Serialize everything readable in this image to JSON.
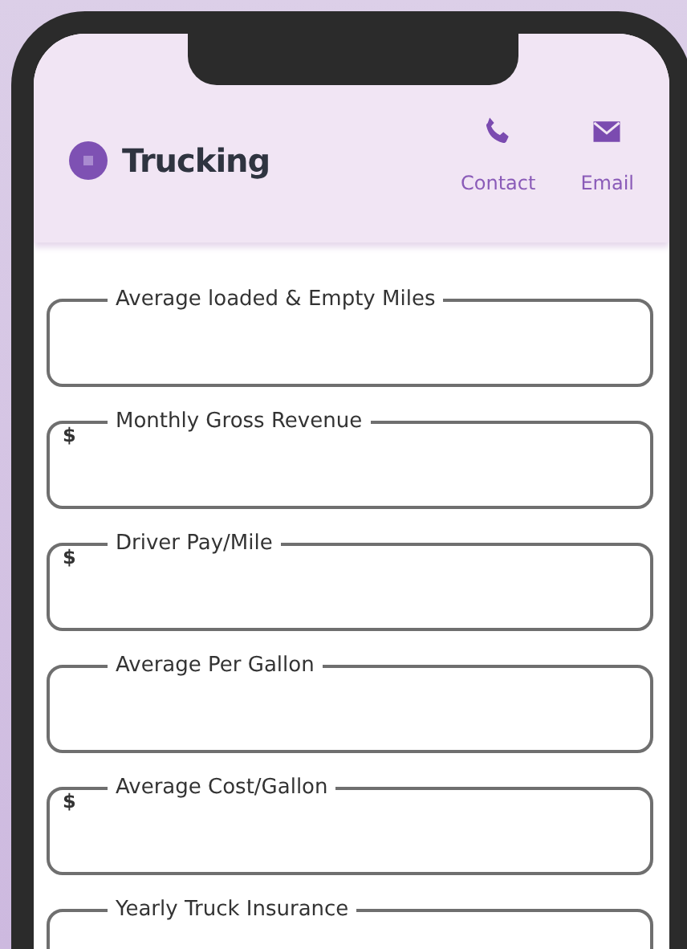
{
  "header": {
    "logo_text": "Trucking",
    "actions": [
      {
        "kind": "phone",
        "label": "Contact"
      },
      {
        "kind": "mail",
        "label": "Email"
      }
    ]
  },
  "fields": [
    {
      "label": "Average loaded & Empty Miles"
    },
    {
      "label": "Monthly Gross Revenue",
      "prefix": "$"
    },
    {
      "label": "Driver Pay/Mile",
      "prefix": "$"
    },
    {
      "label": "Average Per Gallon"
    },
    {
      "label": "Average Cost/Gallon",
      "prefix": "$"
    },
    {
      "label": "Yearly Truck Insurance"
    }
  ]
}
